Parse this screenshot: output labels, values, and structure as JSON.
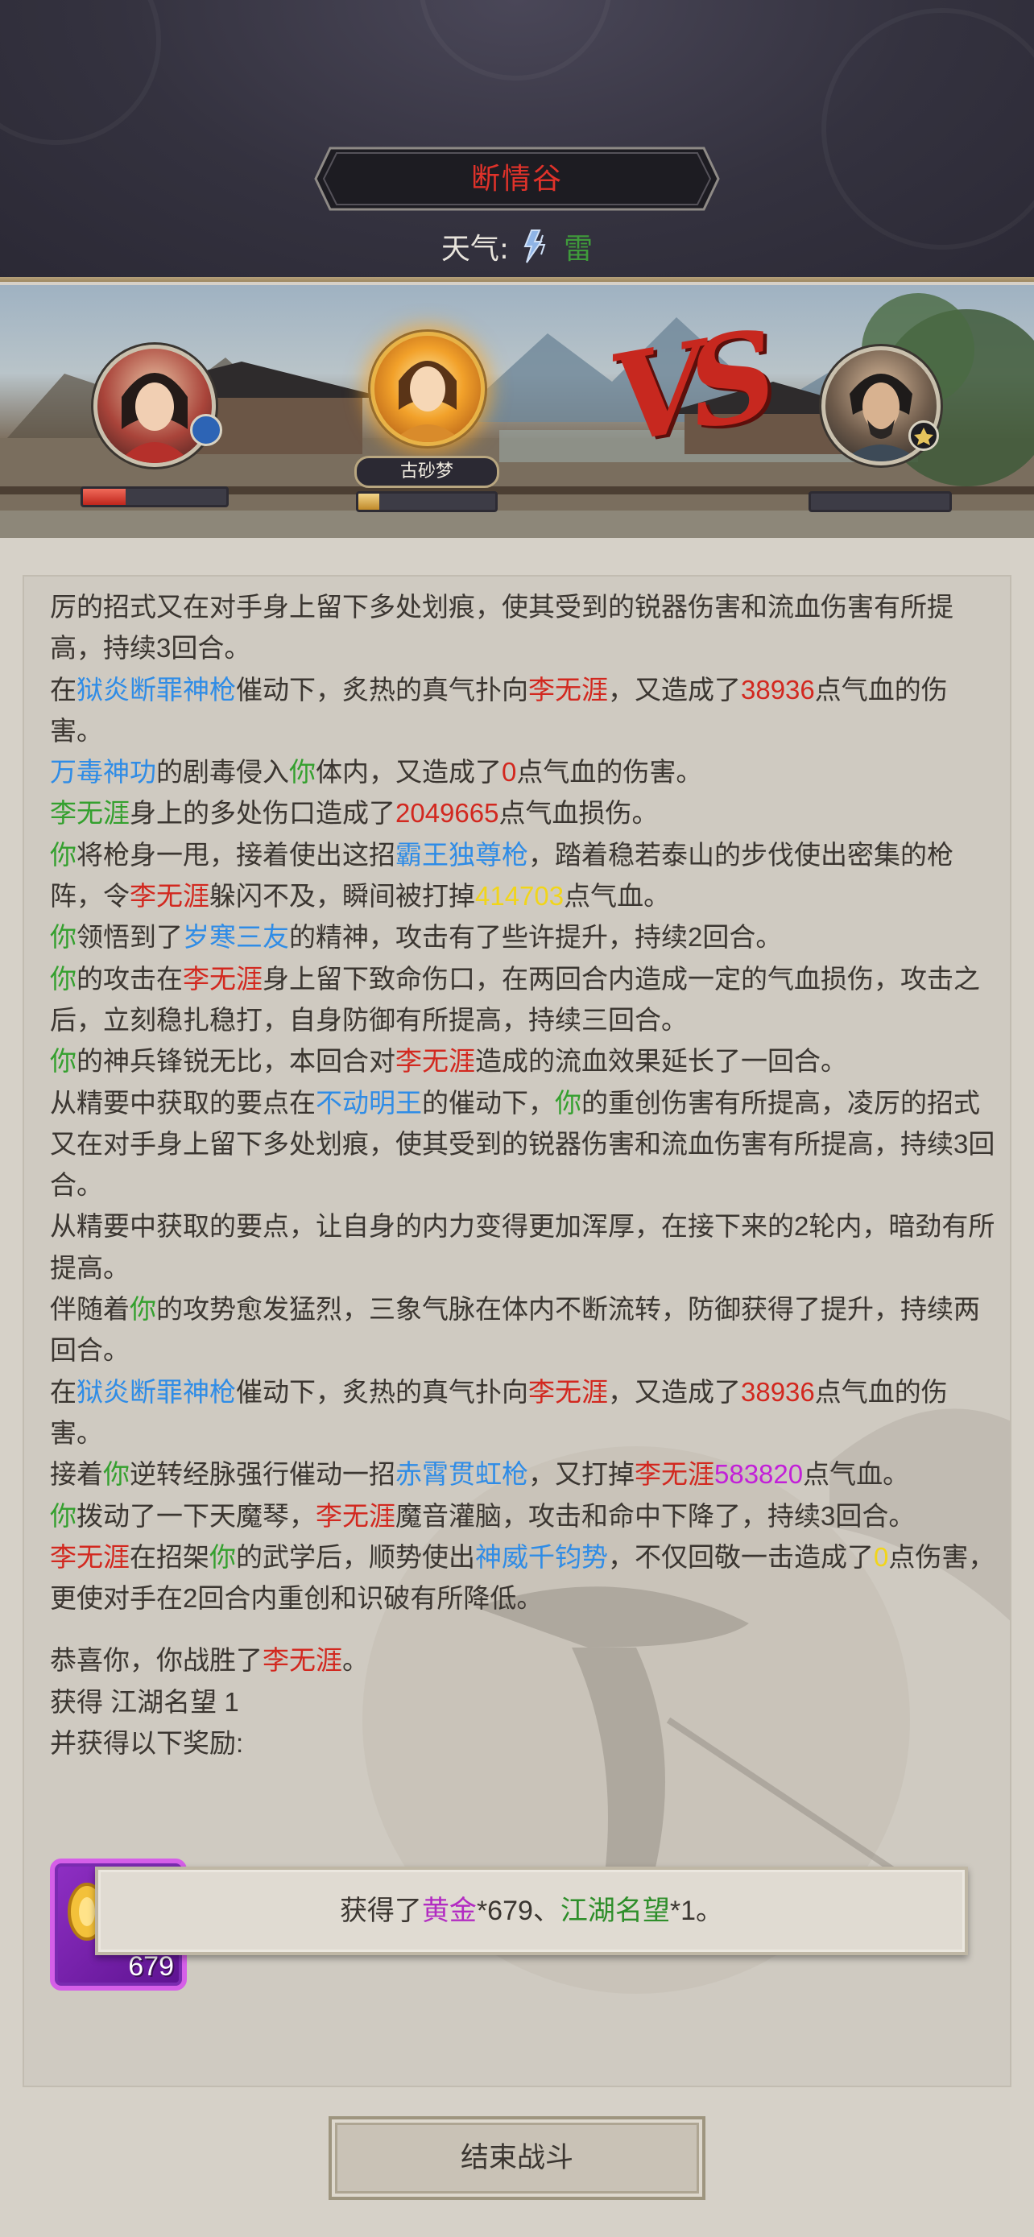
{
  "header": {
    "location": "断情谷",
    "weather_label": "天气:",
    "weather_icon": "lightning-icon",
    "weather_value": "雷"
  },
  "battle": {
    "player_name": "古砂梦",
    "left_portrait_icon": "female-hero-avatar",
    "center_portrait_icon": "glowing-hero-avatar",
    "right_portrait_icon": "male-swordsman-avatar",
    "left_hp": 0.3,
    "center_hp": 0.15,
    "right_hp": 0.0,
    "vs_label": "VS"
  },
  "log": {
    "lines": [
      [
        {
          "t": "厉的招式又在对手身上留下多处划痕，使其受到的锐器伤害和流血伤害有所提高，持续3回合。"
        }
      ],
      [
        {
          "t": "在"
        },
        {
          "t": "狱炎断罪神枪",
          "c": "blue"
        },
        {
          "t": "催动下，炙热的真气扑向"
        },
        {
          "t": "李无涯",
          "c": "red"
        },
        {
          "t": "，又造成了"
        },
        {
          "t": "38936",
          "c": "red"
        },
        {
          "t": "点气血的伤害。"
        }
      ],
      [
        {
          "t": "万毒神功",
          "c": "blue"
        },
        {
          "t": "的剧毒侵入"
        },
        {
          "t": "你",
          "c": "green"
        },
        {
          "t": "体内，又造成了"
        },
        {
          "t": "0",
          "c": "red"
        },
        {
          "t": "点气血的伤害。"
        }
      ],
      [
        {
          "t": "李无涯",
          "c": "green"
        },
        {
          "t": "身上的多处伤口造成了"
        },
        {
          "t": "2049665",
          "c": "red"
        },
        {
          "t": "点气血损伤。"
        }
      ],
      [
        {
          "t": "你",
          "c": "green"
        },
        {
          "t": "将枪身一甩，接着使出这招"
        },
        {
          "t": "霸王独尊枪",
          "c": "blue"
        },
        {
          "t": "，踏着稳若泰山的步伐使出密集的枪阵，令"
        },
        {
          "t": "李无涯",
          "c": "red"
        },
        {
          "t": "躲闪不及，瞬间被打掉"
        },
        {
          "t": "414703",
          "c": "yellow"
        },
        {
          "t": "点气血。"
        }
      ],
      [
        {
          "t": "你",
          "c": "green"
        },
        {
          "t": "领悟到了"
        },
        {
          "t": "岁寒三友",
          "c": "blue"
        },
        {
          "t": "的精神，攻击有了些许提升，持续2回合。"
        }
      ],
      [
        {
          "t": "你",
          "c": "green"
        },
        {
          "t": "的攻击在"
        },
        {
          "t": "李无涯",
          "c": "red"
        },
        {
          "t": "身上留下致命伤口，在两回合内造成一定的气血损伤，攻击之后，立刻稳扎稳打，自身防御有所提高，持续三回合。"
        }
      ],
      [
        {
          "t": "你",
          "c": "green"
        },
        {
          "t": "的神兵锋锐无比，本回合对"
        },
        {
          "t": "李无涯",
          "c": "red"
        },
        {
          "t": "造成的流血效果延长了一回合。"
        }
      ],
      [
        {
          "t": "从精要中获取的要点在"
        },
        {
          "t": "不动明王",
          "c": "blue"
        },
        {
          "t": "的催动下，"
        },
        {
          "t": "你",
          "c": "green"
        },
        {
          "t": "的重创伤害有所提高，凌厉的招式又在对手身上留下多处划痕，使其受到的锐器伤害和流血伤害有所提高，持续3回合。"
        }
      ],
      [
        {
          "t": "从精要中获取的要点，让自身的内力变得更加浑厚，在接下来的2轮内，暗劲有所提高。"
        }
      ],
      [
        {
          "t": "伴随着"
        },
        {
          "t": "你",
          "c": "green"
        },
        {
          "t": "的攻势愈发猛烈，三象气脉在体内不断流转，防御获得了提升，持续两回合。"
        }
      ],
      [
        {
          "t": "在"
        },
        {
          "t": "狱炎断罪神枪",
          "c": "blue"
        },
        {
          "t": "催动下，炙热的真气扑向"
        },
        {
          "t": "李无涯",
          "c": "red"
        },
        {
          "t": "，又造成了"
        },
        {
          "t": "38936",
          "c": "red"
        },
        {
          "t": "点气血的伤害。"
        }
      ],
      [
        {
          "t": "接着"
        },
        {
          "t": "你",
          "c": "green"
        },
        {
          "t": "逆转经脉强行催动一招"
        },
        {
          "t": "赤霄贯虹枪",
          "c": "blue"
        },
        {
          "t": "，又打掉"
        },
        {
          "t": "李无涯",
          "c": "red"
        },
        {
          "t": "583820",
          "c": "purple"
        },
        {
          "t": "点气血。"
        }
      ],
      [
        {
          "t": "你",
          "c": "green"
        },
        {
          "t": "拨动了一下天魔琴，"
        },
        {
          "t": "李无涯",
          "c": "red"
        },
        {
          "t": "魔音灌脑，攻击和命中下降了，持续3回合。"
        }
      ],
      [
        {
          "t": "李无涯",
          "c": "red"
        },
        {
          "t": "在招架"
        },
        {
          "t": "你",
          "c": "green"
        },
        {
          "t": "的武学后，顺势使出"
        },
        {
          "t": "神威千钧势",
          "c": "blue"
        },
        {
          "t": "，不仅回敬一击造成了"
        },
        {
          "t": "0",
          "c": "yellow"
        },
        {
          "t": "点伤害，更使对手在2回合内重创和识破有所降低。"
        }
      ]
    ],
    "victory": [
      {
        "t": "恭喜你，你战胜了"
      },
      {
        "t": "李无涯",
        "c": "red"
      },
      {
        "t": "。"
      }
    ],
    "gain_line": "获得 江湖名望 1",
    "reward_intro": "并获得以下奖励:"
  },
  "reward": {
    "icon": "gold-coin-icon",
    "count": "679"
  },
  "toast": {
    "parts": [
      {
        "t": "获得了"
      },
      {
        "t": "黄金",
        "c": "purple"
      },
      {
        "t": "*679、"
      },
      {
        "t": "江湖名望",
        "c": "green"
      },
      {
        "t": "*1。"
      }
    ]
  },
  "footer": {
    "end_button": "结束战斗"
  },
  "colors": {
    "skill": "#2f8ce6",
    "player": "#34a02e",
    "enemy": "#d2281f",
    "crit": "#f1d51a",
    "special": "#c220d8"
  }
}
